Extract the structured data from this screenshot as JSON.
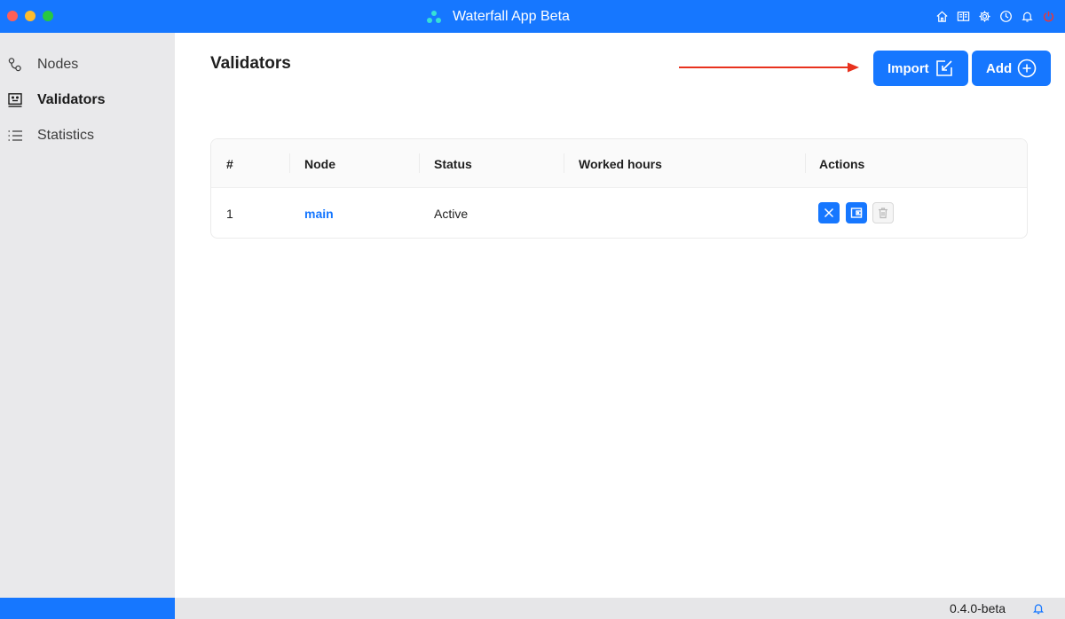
{
  "window": {
    "title": "Waterfall App Beta",
    "accent_color": "#1677ff",
    "titlebar_icons": [
      "home-icon",
      "book-icon",
      "gear-icon",
      "clock-icon",
      "bell-icon",
      "power-icon"
    ]
  },
  "sidebar": {
    "items": [
      {
        "label": "Nodes",
        "icon": "nodes-icon",
        "active": false
      },
      {
        "label": "Validators",
        "icon": "validators-icon",
        "active": true
      },
      {
        "label": "Statistics",
        "icon": "list-icon",
        "active": false
      }
    ]
  },
  "main": {
    "title": "Validators",
    "import_label": "Import",
    "add_label": "Add",
    "table": {
      "columns": [
        "#",
        "Node",
        "Status",
        "Worked hours",
        "Actions"
      ],
      "rows": [
        {
          "index": "1",
          "node": "main",
          "status": "Active",
          "worked_hours": "",
          "actions": [
            "stop-icon",
            "wallet-icon",
            "delete-icon"
          ]
        }
      ]
    }
  },
  "footer": {
    "version": "0.4.0-beta"
  }
}
